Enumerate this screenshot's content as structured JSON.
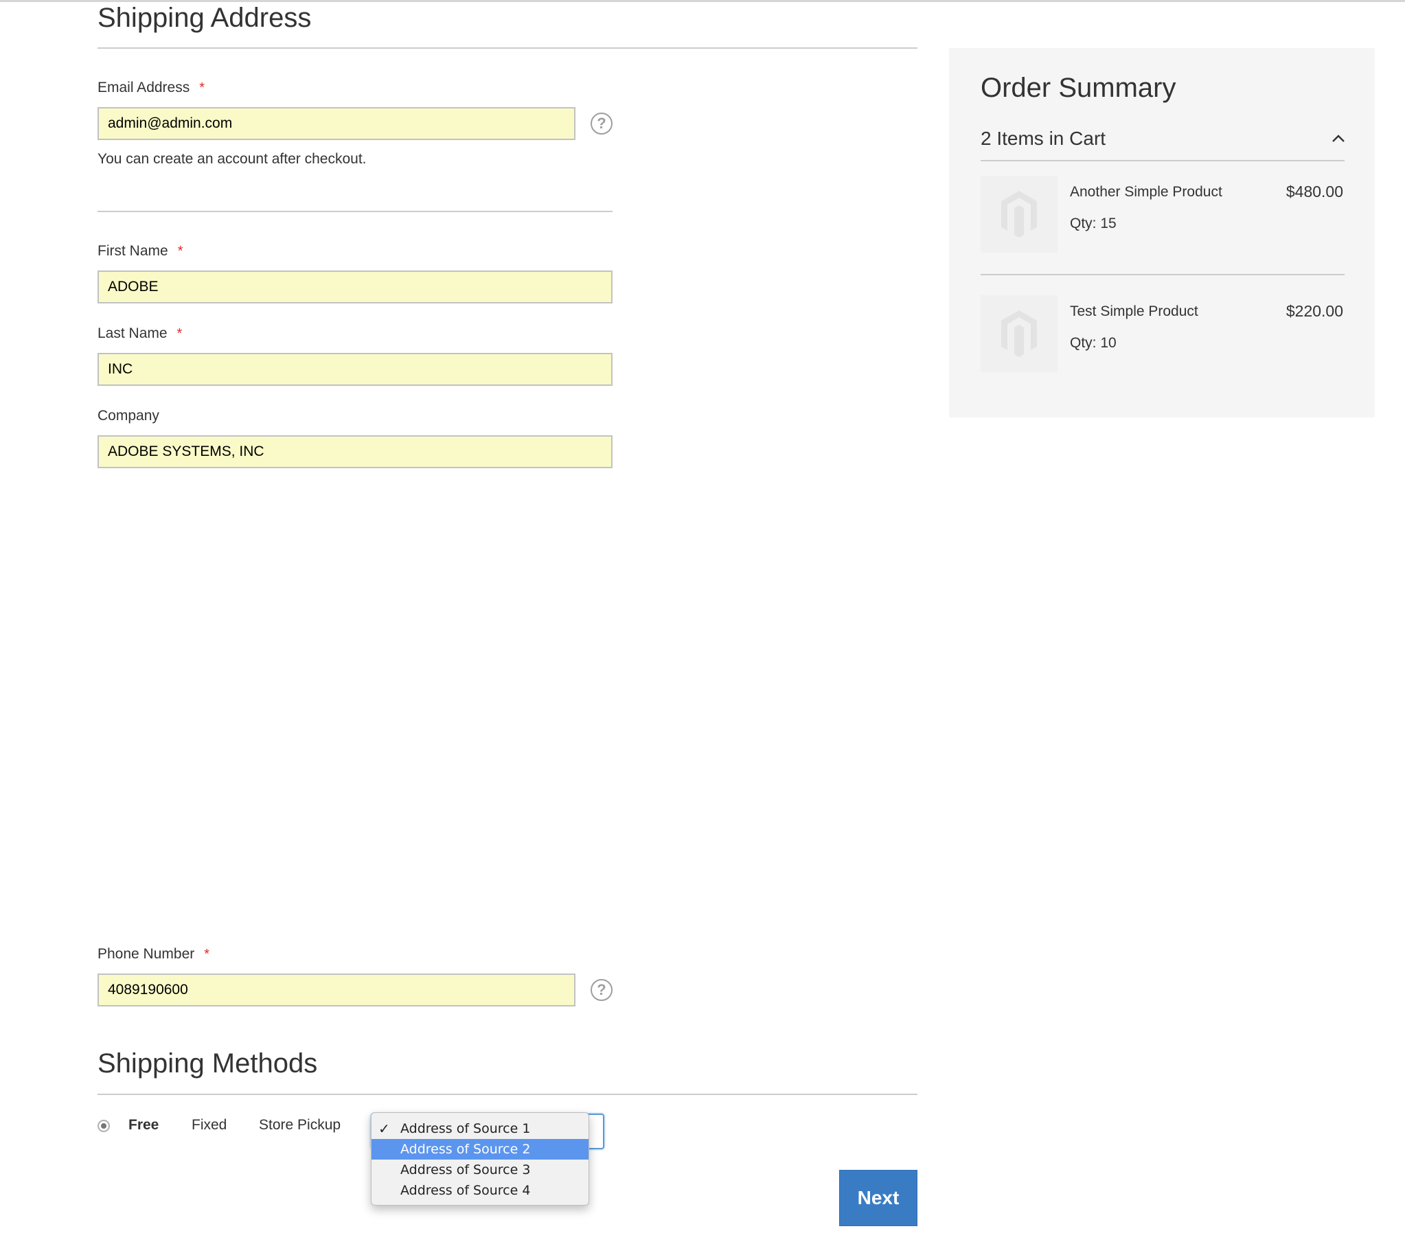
{
  "shipping_address": {
    "title": "Shipping Address",
    "email": {
      "label": "Email Address",
      "required_mark": "*",
      "value": "admin@admin.com",
      "help": "?",
      "note": "You can create an account after checkout."
    },
    "first_name": {
      "label": "First Name",
      "required_mark": "*",
      "value": "ADOBE"
    },
    "last_name": {
      "label": "Last Name",
      "required_mark": "*",
      "value": "INC"
    },
    "company": {
      "label": "Company",
      "value": "ADOBE SYSTEMS, INC"
    },
    "phone": {
      "label": "Phone Number",
      "required_mark": "*",
      "value": "4089190600",
      "help": "?"
    }
  },
  "shipping_methods": {
    "title": "Shipping Methods",
    "options": [
      "Free",
      "Fixed",
      "Store Pickup"
    ],
    "selected": "Free",
    "source_dropdown": {
      "checked": "Address of Source 1",
      "highlighted": "Address of Source 2",
      "options": [
        "Address of Source 1",
        "Address of Source 2",
        "Address of Source 3",
        "Address of Source 4"
      ],
      "check_glyph": "✓"
    }
  },
  "actions": {
    "next_label": "Next"
  },
  "order_summary": {
    "title": "Order Summary",
    "cart_count": "2 Items in Cart",
    "items": [
      {
        "name": "Another Simple Product",
        "qty": "Qty: 15",
        "price": "$480.00"
      },
      {
        "name": "Test Simple Product",
        "qty": "Qty: 10",
        "price": "$220.00"
      }
    ]
  },
  "colors": {
    "field_bg": "#fafac8",
    "accent": "#3a7cc4",
    "required": "#e02b27",
    "summary_bg": "#f5f5f5",
    "dropdown_highlight": "#5b95ee"
  },
  "icons": {
    "help": "question-circle-icon",
    "collapse": "chevron-up-icon",
    "placeholder": "magento-logo-icon"
  }
}
